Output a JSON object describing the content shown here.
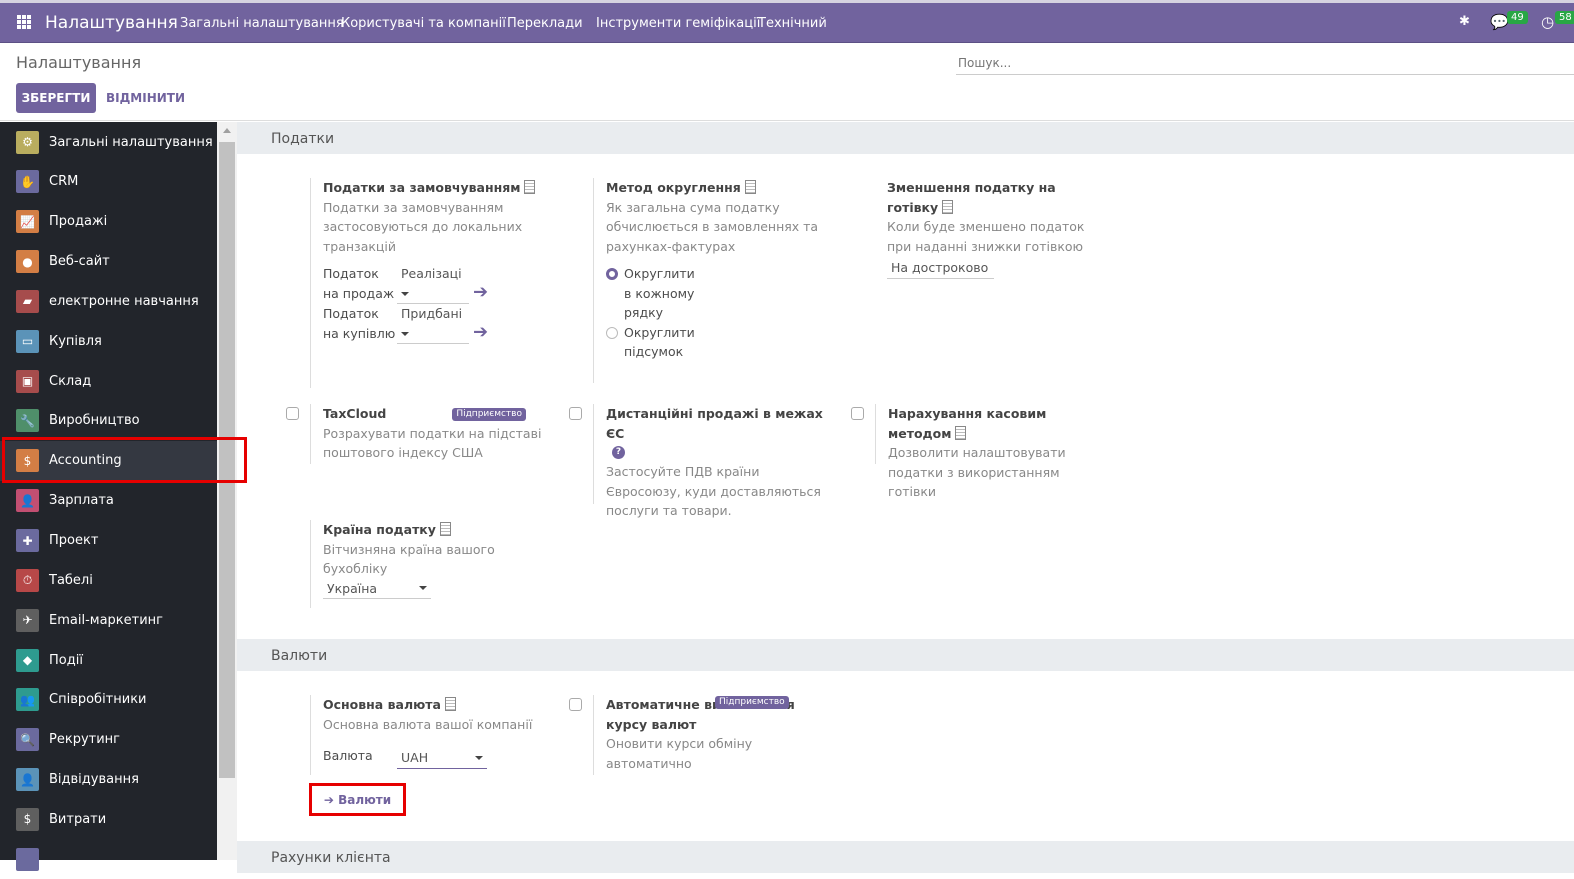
{
  "navbar": {
    "app_title": "Налаштування",
    "menu": [
      "Загальні налаштування",
      "Користувачі та компанії",
      "Переклади",
      "Інструменти геміфікації",
      "Технічний"
    ],
    "messages_count": "49",
    "activities_count": "58"
  },
  "control_panel": {
    "title": "Налаштування",
    "save_label": "ЗБЕРЕГТИ",
    "cancel_label": "ВІДМІНИТИ",
    "search_placeholder": "Пошук..."
  },
  "sidebar": {
    "items": [
      {
        "label": "Загальні налаштування",
        "icon": "gear-icon",
        "color": "#b9ad5f",
        "glyph": "⚙"
      },
      {
        "label": "CRM",
        "icon": "handshake-icon",
        "color": "#6b6a9e",
        "glyph": "✋"
      },
      {
        "label": "Продажі",
        "icon": "chart-icon",
        "color": "#d37e45",
        "glyph": "📈"
      },
      {
        "label": "Веб-сайт",
        "icon": "globe-icon",
        "color": "#d37e45",
        "glyph": "●"
      },
      {
        "label": "електронне навчання",
        "icon": "elearning-icon",
        "color": "#a64c4c",
        "glyph": "▰"
      },
      {
        "label": "Купівля",
        "icon": "credit-card-icon",
        "color": "#5b93b8",
        "glyph": "▭"
      },
      {
        "label": "Склад",
        "icon": "box-icon",
        "color": "#a64c4c",
        "glyph": "▣"
      },
      {
        "label": "Виробництво",
        "icon": "wrench-icon",
        "color": "#4f8f6a",
        "glyph": "🔧"
      },
      {
        "label": "Accounting",
        "icon": "invoice-icon",
        "color": "#d37e45",
        "glyph": "$"
      },
      {
        "label": "Зарплата",
        "icon": "payroll-icon",
        "color": "#c24f72",
        "glyph": "👤"
      },
      {
        "label": "Проект",
        "icon": "puzzle-icon",
        "color": "#6b6a9e",
        "glyph": "✚"
      },
      {
        "label": "Табелі",
        "icon": "stopwatch-icon",
        "color": "#b74848",
        "glyph": "⏱"
      },
      {
        "label": "Email-маркетинг",
        "icon": "paper-plane-icon",
        "color": "#5f5f5f",
        "glyph": "✈"
      },
      {
        "label": "Події",
        "icon": "ticket-icon",
        "color": "#2e9b8f",
        "glyph": "◆"
      },
      {
        "label": "Співробітники",
        "icon": "users-icon",
        "color": "#2e9b8f",
        "glyph": "👥"
      },
      {
        "label": "Рекрутинг",
        "icon": "search-icon",
        "color": "#6b6a9e",
        "glyph": "🔍"
      },
      {
        "label": "Відвідування",
        "icon": "attendance-icon",
        "color": "#5b93b8",
        "glyph": "👤"
      },
      {
        "label": "Витрати",
        "icon": "expenses-icon",
        "color": "#5f5f5f",
        "glyph": "$"
      },
      {
        "label": "",
        "icon": "app-icon",
        "color": "#6b6a9e",
        "glyph": ""
      }
    ],
    "active": "Accounting"
  },
  "taxes": {
    "section_title": "Податки",
    "default_taxes": {
      "label": "Податки за замовчуванням",
      "desc": "Податки за замовчуванням застосовуються до локальних транзакцій",
      "sales_label": "Податок на продаж",
      "sales_value": "Реалізаці",
      "purchase_label": "Податок на купівлю",
      "purchase_value": "Придбані"
    },
    "rounding": {
      "label": "Метод округлення",
      "desc": "Як загальна сума податку обчислюється в замовленнях та рахунках-фактурах",
      "options": [
        "Округлити в кожному рядку",
        "Округлити підсумок"
      ],
      "selected": 0
    },
    "cash_discount": {
      "label": "Зменшення податку на готівку",
      "desc": "Коли буде зменшено податок при наданні знижки готівкою",
      "value": "На достроково"
    },
    "taxcloud": {
      "label": "TaxCloud",
      "badge": "Підприємство",
      "desc": "Розрахувати податки на підставі поштового індексу США",
      "checked": false
    },
    "eu_distance": {
      "label": "Дистанційні продажі в межах ЄС",
      "desc": "Застосуйте ПДВ країни Євросоюзу, куди доставляються послуги та товари.",
      "checked": false
    },
    "cash_basis": {
      "label": "Нарахування касовим методом",
      "desc": "Дозволити налаштовувати податки з використанням готівки",
      "checked": false
    },
    "fiscal_country": {
      "label": "Країна податку",
      "desc": "Вітчизняна країна вашого бухобліку",
      "value": "Україна"
    }
  },
  "currencies": {
    "section_title": "Валюти",
    "main_currency": {
      "label": "Основна валюта",
      "desc": "Основна валюта вашої компанії",
      "field_label": "Валюта",
      "value": "UAH",
      "link": "Валюти"
    },
    "auto_rates": {
      "label": "Автоматичне виставлення курсу валют",
      "badge": "Підприємство",
      "desc": "Оновити курси обміну автоматично",
      "checked": false
    }
  },
  "next_section": "Рахунки клієнта"
}
